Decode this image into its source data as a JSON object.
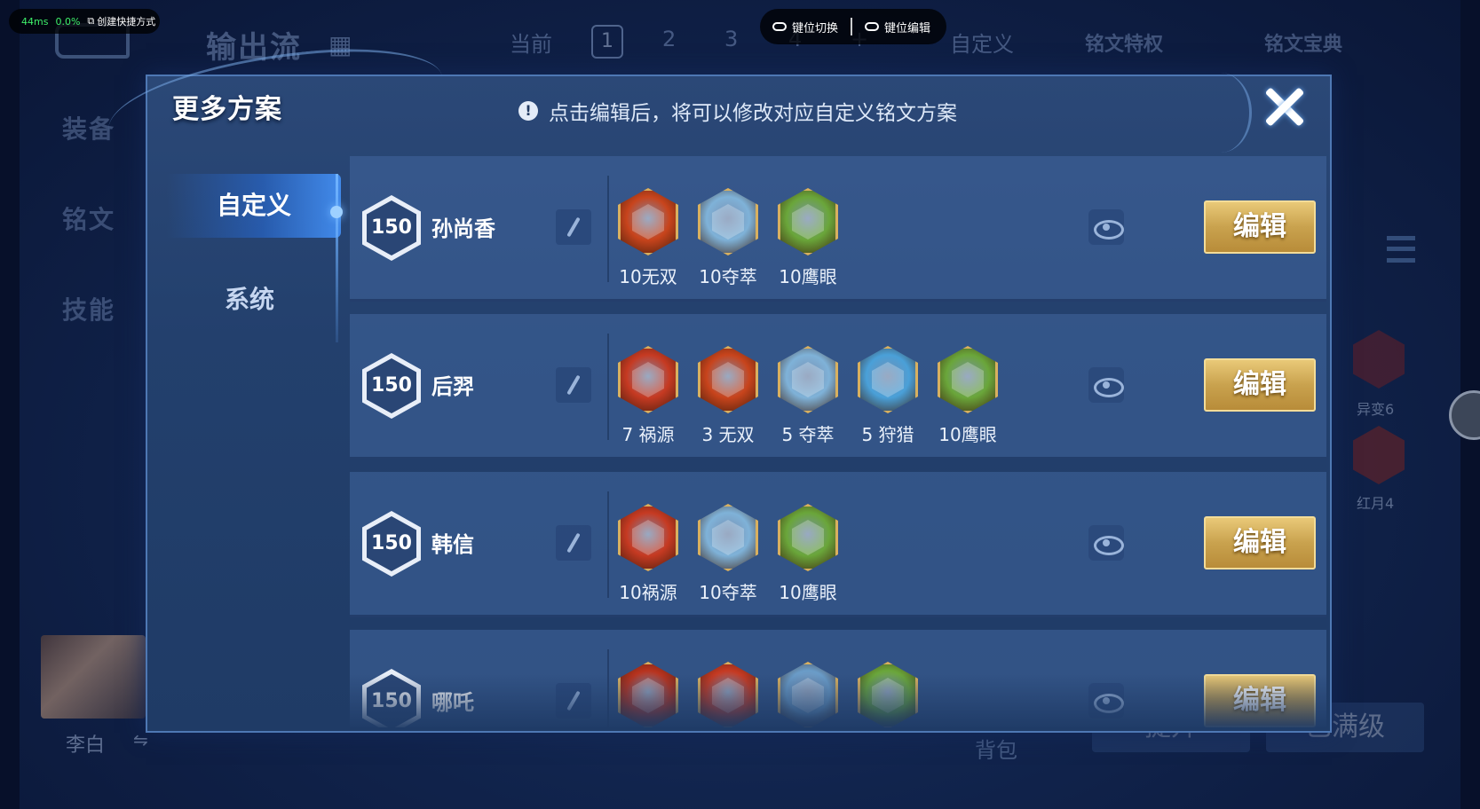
{
  "overlay": {
    "ping": "44ms",
    "loss": "0.0%",
    "shortcut": "创建快捷方式",
    "key_switch": "键位切换",
    "key_edit": "键位编辑"
  },
  "background": {
    "title": "输出流",
    "tabs": [
      "当前",
      "1",
      "2",
      "3",
      "4",
      "+",
      "自定义"
    ],
    "rune_privilege": "铭文特权",
    "rune_codex": "铭文宝典",
    "side": [
      "装备",
      "铭文",
      "技能"
    ],
    "hero_name": "李白",
    "bag": "背包",
    "upgrade": "提升",
    "max_level": "已满级",
    "badges": [
      "异变6",
      "红月4"
    ]
  },
  "modal": {
    "title": "更多方案",
    "hint": "点击编辑后，将可以修改对应自定义铭文方案",
    "tabs": {
      "custom": "自定义",
      "system": "系统"
    },
    "edit_label": "编辑",
    "rows": [
      {
        "level": "150",
        "hero": "孙尚香",
        "runes": [
          {
            "label": "10无双",
            "color": "#c8441c"
          },
          {
            "label": "10夺萃",
            "color": "#7fb2d8"
          },
          {
            "label": "10鹰眼",
            "color": "#6aa63a"
          }
        ]
      },
      {
        "level": "150",
        "hero": "后羿",
        "runes": [
          {
            "label": "7 祸源",
            "color": "#c63a22"
          },
          {
            "label": "3 无双",
            "color": "#c8441c"
          },
          {
            "label": "5 夺萃",
            "color": "#7fb2d8"
          },
          {
            "label": "5 狩猎",
            "color": "#4aa0d8"
          },
          {
            "label": "10鹰眼",
            "color": "#6aa63a"
          }
        ]
      },
      {
        "level": "150",
        "hero": "韩信",
        "runes": [
          {
            "label": "10祸源",
            "color": "#c63a22"
          },
          {
            "label": "10夺萃",
            "color": "#7fb2d8"
          },
          {
            "label": "10鹰眼",
            "color": "#6aa63a"
          }
        ]
      },
      {
        "level": "150",
        "hero": "哪吒",
        "runes": [
          {
            "label": "",
            "color": "#b8331e"
          },
          {
            "label": "",
            "color": "#c63a22"
          },
          {
            "label": "",
            "color": "#6a9cc8"
          },
          {
            "label": "",
            "color": "#6aa63a"
          }
        ]
      }
    ]
  }
}
